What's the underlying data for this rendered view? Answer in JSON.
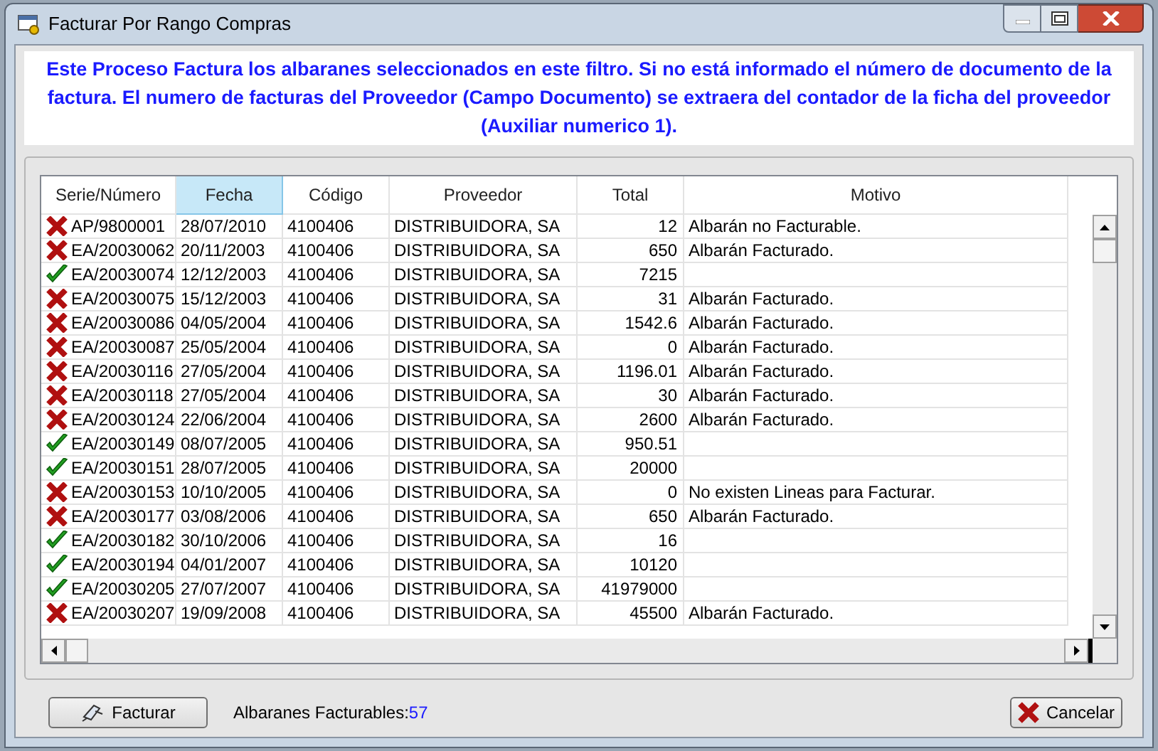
{
  "window": {
    "title": "Facturar Por Rango Compras"
  },
  "info": "Este Proceso Factura los albaranes seleccionados en este filtro. Si no está informado el número de documento de la factura. El numero de facturas del Proveedor (Campo Documento) se extraera del contador de la ficha del proveedor (Auxiliar numerico 1).",
  "table": {
    "columns": [
      {
        "label": "Serie/Número",
        "selected": false
      },
      {
        "label": "Fecha",
        "selected": true
      },
      {
        "label": "Código",
        "selected": false
      },
      {
        "label": "Proveedor",
        "selected": false
      },
      {
        "label": "Total",
        "selected": false
      },
      {
        "label": "Motivo",
        "selected": false
      }
    ],
    "rows": [
      {
        "valid": false,
        "serie": "AP/9800001",
        "fecha": "28/07/2010",
        "codigo": "4100406",
        "proveedor": "DISTRIBUIDORA, SA",
        "total": "12",
        "motivo": "Albarán no Facturable."
      },
      {
        "valid": false,
        "serie": "EA/20030062",
        "fecha": "20/11/2003",
        "codigo": "4100406",
        "proveedor": "DISTRIBUIDORA, SA",
        "total": "650",
        "motivo": "Albarán Facturado."
      },
      {
        "valid": true,
        "serie": "EA/20030074",
        "fecha": "12/12/2003",
        "codigo": "4100406",
        "proveedor": "DISTRIBUIDORA, SA",
        "total": "7215"
      },
      {
        "valid": false,
        "serie": "EA/20030075",
        "fecha": "15/12/2003",
        "codigo": "4100406",
        "proveedor": "DISTRIBUIDORA, SA",
        "total": "31",
        "motivo": "Albarán Facturado."
      },
      {
        "valid": false,
        "serie": "EA/20030086",
        "fecha": "04/05/2004",
        "codigo": "4100406",
        "proveedor": "DISTRIBUIDORA, SA",
        "total": "1542.6",
        "motivo": "Albarán Facturado."
      },
      {
        "valid": false,
        "serie": "EA/20030087",
        "fecha": "25/05/2004",
        "codigo": "4100406",
        "proveedor": "DISTRIBUIDORA, SA",
        "total": "0",
        "motivo": "Albarán Facturado."
      },
      {
        "valid": false,
        "serie": "EA/20030116",
        "fecha": "27/05/2004",
        "codigo": "4100406",
        "proveedor": "DISTRIBUIDORA, SA",
        "total": "1196.01",
        "motivo": "Albarán Facturado."
      },
      {
        "valid": false,
        "serie": "EA/20030118",
        "fecha": "27/05/2004",
        "codigo": "4100406",
        "proveedor": "DISTRIBUIDORA, SA",
        "total": "30",
        "motivo": "Albarán Facturado."
      },
      {
        "valid": false,
        "serie": "EA/20030124",
        "fecha": "22/06/2004",
        "codigo": "4100406",
        "proveedor": "DISTRIBUIDORA, SA",
        "total": "2600",
        "motivo": "Albarán Facturado."
      },
      {
        "valid": true,
        "serie": "EA/20030149",
        "fecha": "08/07/2005",
        "codigo": "4100406",
        "proveedor": "DISTRIBUIDORA, SA",
        "total": "950.51"
      },
      {
        "valid": true,
        "serie": "EA/20030151",
        "fecha": "28/07/2005",
        "codigo": "4100406",
        "proveedor": "DISTRIBUIDORA, SA",
        "total": "20000"
      },
      {
        "valid": false,
        "serie": "EA/20030153",
        "fecha": "10/10/2005",
        "codigo": "4100406",
        "proveedor": "DISTRIBUIDORA, SA",
        "total": "0",
        "motivo": "No existen Lineas para Facturar."
      },
      {
        "valid": false,
        "serie": "EA/20030177",
        "fecha": "03/08/2006",
        "codigo": "4100406",
        "proveedor": "DISTRIBUIDORA, SA",
        "total": "650",
        "motivo": "Albarán Facturado."
      },
      {
        "valid": true,
        "serie": "EA/20030182",
        "fecha": "30/10/2006",
        "codigo": "4100406",
        "proveedor": "DISTRIBUIDORA, SA",
        "total": "16"
      },
      {
        "valid": true,
        "serie": "EA/20030194",
        "fecha": "04/01/2007",
        "codigo": "4100406",
        "proveedor": "DISTRIBUIDORA, SA",
        "total": "10120"
      },
      {
        "valid": true,
        "serie": "EA/20030205",
        "fecha": "27/07/2007",
        "codigo": "4100406",
        "proveedor": "DISTRIBUIDORA, SA",
        "total": "41979000"
      },
      {
        "valid": false,
        "serie": "EA/20030207",
        "fecha": "19/09/2008",
        "codigo": "4100406",
        "proveedor": "DISTRIBUIDORA, SA",
        "total": "45500",
        "motivo": "Albarán Facturado."
      }
    ]
  },
  "footer": {
    "invoice_button": "Facturar",
    "count_label": "Albaranes Facturables:",
    "count": "57",
    "cancel_button": "Cancelar"
  }
}
